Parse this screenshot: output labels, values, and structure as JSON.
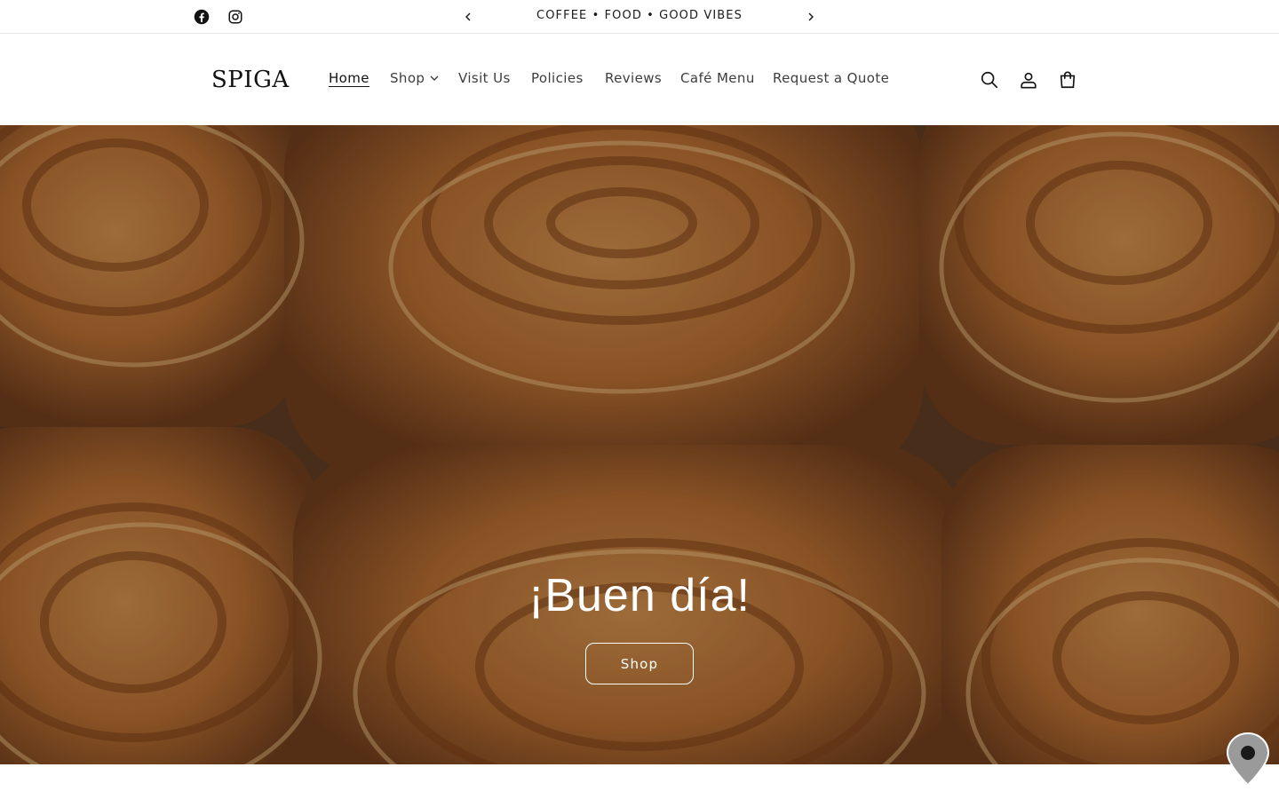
{
  "announcement": {
    "text": "COFFEE • FOOD • GOOD VIBES",
    "social": [
      "facebook-icon",
      "instagram-icon"
    ],
    "prev_icon": "chevron-left-icon",
    "next_icon": "chevron-right-icon"
  },
  "header": {
    "logo": "SPIGA",
    "nav": [
      {
        "label": "Home",
        "active": true
      },
      {
        "label": "Shop",
        "has_dropdown": true
      },
      {
        "label": "Visit Us"
      },
      {
        "label": "Policies"
      },
      {
        "label": "Reviews"
      },
      {
        "label": "Café Menu"
      },
      {
        "label": "Request a Quote"
      }
    ],
    "icons": [
      "search-icon",
      "account-icon",
      "cart-icon"
    ]
  },
  "hero": {
    "title": "¡Buen día!",
    "button_label": "Shop"
  },
  "floating": {
    "icon": "map-pin-icon"
  },
  "colors": {
    "hero_text": "#ffffff",
    "nav_text": "#3d3d3d",
    "border": "#e6e6e6"
  }
}
